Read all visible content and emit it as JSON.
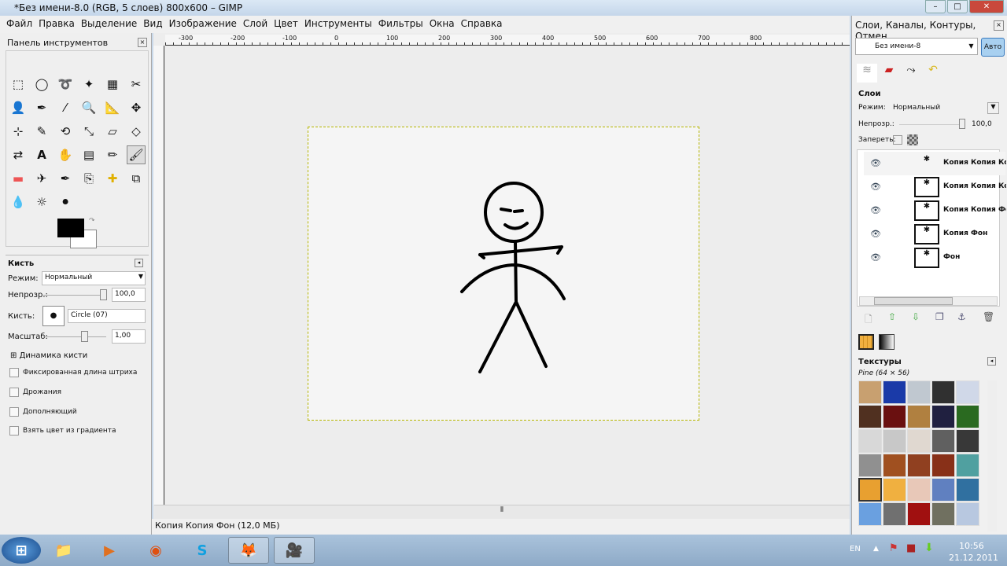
{
  "window": {
    "title": "*Без имени-8.0 (RGB, 5 слоев) 800x600 – GIMP"
  },
  "menu": [
    "Файл",
    "Правка",
    "Выделение",
    "Вид",
    "Изображение",
    "Слой",
    "Цвет",
    "Инструменты",
    "Фильтры",
    "Окна",
    "Справка"
  ],
  "toolbox": {
    "title": "Панель инструментов",
    "tools": [
      "rect-select",
      "ellipse-select",
      "free-select",
      "fuzzy-select",
      "color-select",
      "scissors",
      "foreground-select",
      "paths",
      "color-picker",
      "zoom",
      "measure",
      "move",
      "align",
      "crop",
      "rotate",
      "scale",
      "shear",
      "perspective",
      "flip",
      "text",
      "cage",
      "blend",
      "pencil",
      "paintbrush",
      "eraser",
      "airbrush",
      "ink",
      "clone",
      "heal",
      "perspective-clone",
      "smudge",
      "dodge-burn",
      "blur"
    ],
    "fg_color": "#000000",
    "bg_color": "#ffffff"
  },
  "tool_options": {
    "title": "Кисть",
    "mode_label": "Режим:",
    "mode": "Нормальный",
    "opacity_label": "Непрозр.:",
    "opacity": "100,0",
    "brush_label": "Кисть:",
    "brush": "Circle (07)",
    "scale_label": "Масштаб:",
    "scale": "1,00",
    "dynamics": "Динамика кисти",
    "checkboxes": [
      "Фиксированная длина штриха",
      "Дрожания",
      "Дополняющий",
      "Взять цвет из градиента"
    ]
  },
  "rulers": [
    "-300",
    "-200",
    "-100",
    "0",
    "100",
    "200",
    "300",
    "400",
    "500",
    "600",
    "700",
    "800"
  ],
  "status": "Копия Копия Фон (12,0 МБ)",
  "dock": {
    "title": "Слои, Каналы, Контуры, Отмен...",
    "image_select": "Без имени-8",
    "auto_button": "Авто",
    "layers_title": "Слои",
    "mode_label": "Режим:",
    "mode": "Нормальный",
    "opacity_label": "Непрозр.:",
    "opacity": "100,0",
    "lock_label": "Запереть:",
    "layers": [
      "Копия Копия Кон",
      "Копия Копия Кон",
      "Копия Копия Фон",
      "Копия Фон",
      "Фон"
    ],
    "textures_title": "Текстуры",
    "texture_selected": "Pine (64 × 56)",
    "texture_colors": [
      "#c8a070",
      "#1a3aa8",
      "#c0c8d0",
      "#303030",
      "#d0d8e8",
      "#503020",
      "#6a1010",
      "#b08040",
      "#202040",
      "#2a6a20",
      "#d8d8d8",
      "#c8c8c8",
      "#e0d8d0",
      "#606060",
      "#383838",
      "#909090",
      "#a05020",
      "#904020",
      "#883018",
      "#50a0a0",
      "#e8a030",
      "#f0b040",
      "#e8c8b8",
      "#6080c0",
      "#3070a0",
      "#6aa0e0",
      "#707070",
      "#a01010",
      "#707060",
      "#b8c8e0"
    ]
  },
  "taskbar": {
    "lang": "EN",
    "time": "10:56",
    "date": "21.12.2011"
  }
}
